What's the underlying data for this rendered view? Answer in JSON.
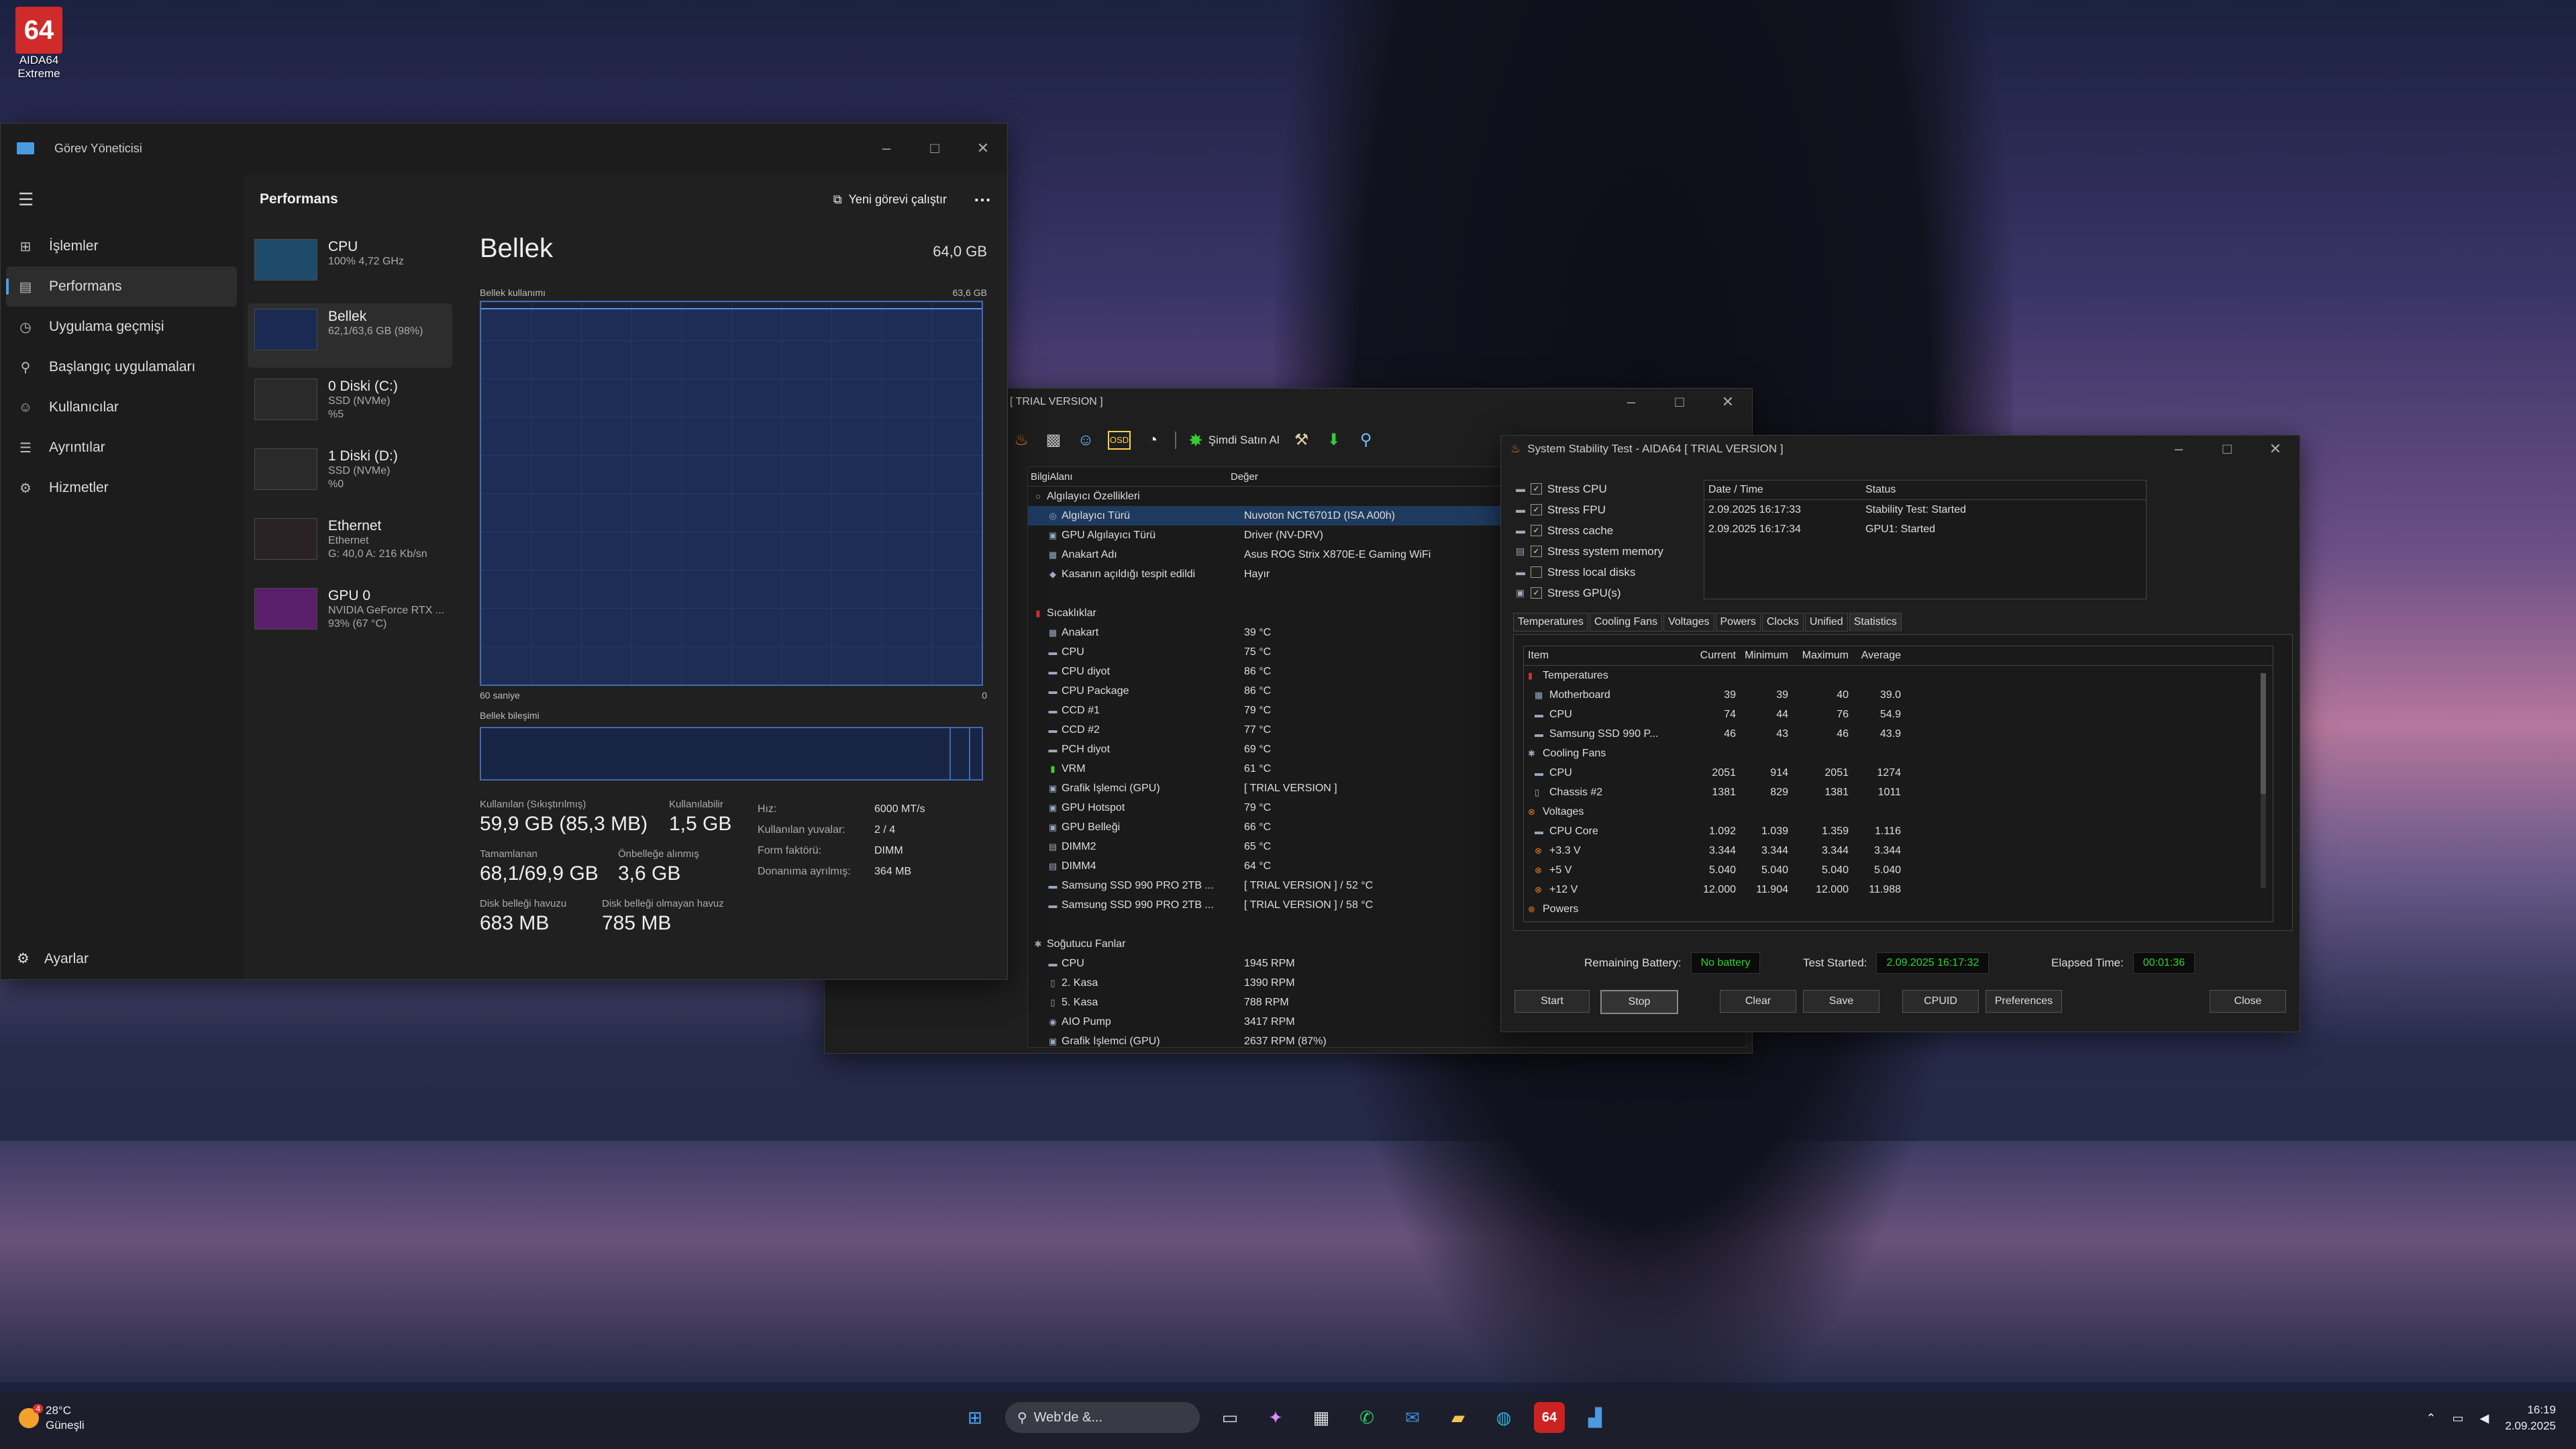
{
  "desktop": {
    "icon_tile": "64",
    "icon_label_1": "AIDA64",
    "icon_label_2": "Extreme"
  },
  "taskmgr": {
    "title": "Görev Yöneticisi",
    "nav": [
      {
        "label": "İşlemler",
        "icon": "grid-icon"
      },
      {
        "label": "Performans",
        "icon": "chart-icon"
      },
      {
        "label": "Uygulama geçmişi",
        "icon": "history-icon"
      },
      {
        "label": "Başlangıç uygulamaları",
        "icon": "startup-icon"
      },
      {
        "label": "Kullanıcılar",
        "icon": "users-icon"
      },
      {
        "label": "Ayrıntılar",
        "icon": "list-icon"
      },
      {
        "label": "Hizmetler",
        "icon": "services-icon"
      }
    ],
    "settings": "Ayarlar",
    "section_title": "Performans",
    "new_task": "Yeni görevi çalıştır",
    "devices": [
      {
        "name": "CPU",
        "l2": "100% 4,72 GHz",
        "l3": "",
        "color": "#1f4b6a"
      },
      {
        "name": "Bellek",
        "l2": "62,1/63,6 GB (98%)",
        "l3": "",
        "color": "#1a2a52"
      },
      {
        "name": "0 Diski (C:)",
        "l2": "SSD (NVMe)",
        "l3": "%5",
        "color": "#2a2a2a"
      },
      {
        "name": "1 Diski (D:)",
        "l2": "SSD (NVMe)",
        "l3": "%0",
        "color": "#2a2a2a"
      },
      {
        "name": "Ethernet",
        "l2": "Ethernet",
        "l3": "G: 40,0  A: 216 Kb/sn",
        "color": "#2b2226"
      },
      {
        "name": "GPU 0",
        "l2": "NVIDIA GeForce RTX ...",
        "l3": "93% (67 °C)",
        "color": "#5a1f6a"
      }
    ],
    "memory": {
      "title": "Bellek",
      "total": "64,0 GB",
      "usage_label": "Bellek kullanımı",
      "usage_max": "63,6 GB",
      "time_left": "60 saniye",
      "time_right": "0",
      "composition_label": "Bellek bileşimi",
      "used_fraction": 0.98,
      "stats": [
        {
          "k": "Kullanılan (Sıkıştırılmış)",
          "v": "59,9 GB (85,3 MB)"
        },
        {
          "k": "Kullanılabilir",
          "v": "1,5 GB"
        },
        {
          "k": "Tamamlanan",
          "v": "68,1/69,9 GB"
        },
        {
          "k": "Önbelleğe alınmış",
          "v": "3,6 GB"
        },
        {
          "k": "Disk belleği havuzu",
          "v": "683 MB"
        },
        {
          "k": "Disk belleği olmayan havuz",
          "v": "785 MB"
        }
      ],
      "kv": [
        {
          "k": "Hız:",
          "v": "6000 MT/s"
        },
        {
          "k": "Kullanılan yuvalar:",
          "v": "2 / 4"
        },
        {
          "k": "Form faktörü:",
          "v": "DIMM"
        },
        {
          "k": "Donanıma ayrılmış:",
          "v": "364 MB"
        }
      ]
    }
  },
  "aida": {
    "title": "[ TRIAL VERSION ]",
    "buy": "Şimdi Satın Al",
    "col1": "BilgiAlanı",
    "col2": "Değer",
    "rows": [
      {
        "l": "Algılayıcı Özellikleri",
        "v": "",
        "lvl": 0,
        "ic": "○"
      },
      {
        "l": "Algılayıcı Türü",
        "v": "Nuvoton NCT6701D  (ISA A00h)",
        "lvl": 1,
        "ic": "◎",
        "sel": true
      },
      {
        "l": "GPU Algılayıcı Türü",
        "v": "Driver  (NV-DRV)",
        "lvl": 1,
        "ic": "▣"
      },
      {
        "l": "Anakart Adı",
        "v": "Asus ROG Strix X870E-E Gaming WiFi",
        "lvl": 1,
        "ic": "▦"
      },
      {
        "l": "Kasanın açıldığı tespit edildi",
        "v": "Hayır",
        "lvl": 1,
        "ic": "◆"
      },
      {
        "l": "",
        "v": "",
        "lvl": 0,
        "ic": ""
      },
      {
        "l": "Sıcaklıklar",
        "v": "",
        "lvl": 0,
        "ic": "▮",
        "red": true
      },
      {
        "l": "Anakart",
        "v": "39 °C",
        "lvl": 1,
        "ic": "▦"
      },
      {
        "l": "CPU",
        "v": "75 °C",
        "lvl": 1,
        "ic": "▬"
      },
      {
        "l": "CPU diyot",
        "v": "86 °C",
        "lvl": 1,
        "ic": "▬"
      },
      {
        "l": "CPU Package",
        "v": "86 °C",
        "lvl": 1,
        "ic": "▬"
      },
      {
        "l": "CCD #1",
        "v": "79 °C",
        "lvl": 1,
        "ic": "▬"
      },
      {
        "l": "CCD #2",
        "v": "77 °C",
        "lvl": 1,
        "ic": "▬"
      },
      {
        "l": "PCH diyot",
        "v": "69 °C",
        "lvl": 1,
        "ic": "▬"
      },
      {
        "l": "VRM",
        "v": "61 °C",
        "lvl": 1,
        "ic": "▮",
        "g": true
      },
      {
        "l": "Grafik İşlemci (GPU)",
        "v": "[ TRIAL VERSION ]",
        "lvl": 1,
        "ic": "▣"
      },
      {
        "l": "GPU Hotspot",
        "v": "79 °C",
        "lvl": 1,
        "ic": "▣"
      },
      {
        "l": "GPU Belleği",
        "v": "66 °C",
        "lvl": 1,
        "ic": "▣"
      },
      {
        "l": "DIMM2",
        "v": "65 °C",
        "lvl": 1,
        "ic": "▤"
      },
      {
        "l": "DIMM4",
        "v": "64 °C",
        "lvl": 1,
        "ic": "▤"
      },
      {
        "l": "Samsung SSD 990 PRO 2TB ...",
        "v": "[ TRIAL VERSION ] / 52 °C",
        "lvl": 1,
        "ic": "▬"
      },
      {
        "l": "Samsung SSD 990 PRO 2TB ...",
        "v": "[ TRIAL VERSION ] / 58 °C",
        "lvl": 1,
        "ic": "▬"
      },
      {
        "l": "",
        "v": "",
        "lvl": 0,
        "ic": ""
      },
      {
        "l": "Soğutucu Fanlar",
        "v": "",
        "lvl": 0,
        "ic": "✱"
      },
      {
        "l": "CPU",
        "v": "1945 RPM",
        "lvl": 1,
        "ic": "▬"
      },
      {
        "l": "2. Kasa",
        "v": "1390 RPM",
        "lvl": 1,
        "ic": "▯"
      },
      {
        "l": "5. Kasa",
        "v": "788 RPM",
        "lvl": 1,
        "ic": "▯"
      },
      {
        "l": "AIO Pump",
        "v": "3417 RPM",
        "lvl": 1,
        "ic": "◉"
      },
      {
        "l": "Grafik İşlemci (GPU)",
        "v": "2637 RPM  (87%)",
        "lvl": 1,
        "ic": "▣"
      }
    ]
  },
  "sst": {
    "title": "System Stability Test - AIDA64  [ TRIAL VERSION ]",
    "stress": [
      {
        "label": "Stress CPU",
        "checked": true
      },
      {
        "label": "Stress FPU",
        "checked": true
      },
      {
        "label": "Stress cache",
        "checked": true
      },
      {
        "label": "Stress system memory",
        "checked": true
      },
      {
        "label": "Stress local disks",
        "checked": false
      },
      {
        "label": "Stress GPU(s)",
        "checked": true
      }
    ],
    "log_header": [
      "Date / Time",
      "Status"
    ],
    "log": [
      [
        "2.09.2025 16:17:33",
        "Stability Test: Started"
      ],
      [
        "2.09.2025 16:17:34",
        "GPU1: Started"
      ]
    ],
    "tabs": [
      "Temperatures",
      "Cooling Fans",
      "Voltages",
      "Powers",
      "Clocks",
      "Unified",
      "Statistics"
    ],
    "stat_header": [
      "Item",
      "Current",
      "Minimum",
      "Maximum",
      "Average"
    ],
    "stat_rows": [
      {
        "item": "Temperatures",
        "group": true,
        "ic": "▮",
        "c": "red"
      },
      {
        "item": "Motherboard",
        "v": [
          "39",
          "39",
          "40",
          "39.0"
        ],
        "ic": "▦"
      },
      {
        "item": "CPU",
        "v": [
          "74",
          "44",
          "76",
          "54.9"
        ],
        "ic": "▬"
      },
      {
        "item": "Samsung SSD 990 P...",
        "v": [
          "46",
          "43",
          "46",
          "43.9"
        ],
        "ic": "▬"
      },
      {
        "item": "Cooling Fans",
        "group": true,
        "ic": "✱"
      },
      {
        "item": "CPU",
        "v": [
          "2051",
          "914",
          "2051",
          "1274"
        ],
        "ic": "▬"
      },
      {
        "item": "Chassis #2",
        "v": [
          "1381",
          "829",
          "1381",
          "1011"
        ],
        "ic": "▯"
      },
      {
        "item": "Voltages",
        "group": true,
        "ic": "⊗",
        "c": "orange"
      },
      {
        "item": "CPU Core",
        "v": [
          "1.092",
          "1.039",
          "1.359",
          "1.116"
        ],
        "ic": "▬"
      },
      {
        "item": "+3.3 V",
        "v": [
          "3.344",
          "3.344",
          "3.344",
          "3.344"
        ],
        "ic": "⊗",
        "c": "orange"
      },
      {
        "item": "+5 V",
        "v": [
          "5.040",
          "5.040",
          "5.040",
          "5.040"
        ],
        "ic": "⊗",
        "c": "orange"
      },
      {
        "item": "+12 V",
        "v": [
          "12.000",
          "11.904",
          "12.000",
          "11.988"
        ],
        "ic": "⊗",
        "c": "orange"
      },
      {
        "item": "Powers",
        "group": true,
        "ic": "⊗",
        "c": "orange"
      }
    ],
    "remaining_battery_label": "Remaining Battery:",
    "remaining_battery": "No battery",
    "test_started_label": "Test Started:",
    "test_started": "2.09.2025 16:17:32",
    "elapsed_label": "Elapsed Time:",
    "elapsed": "00:01:36",
    "buttons": {
      "start": "Start",
      "stop": "Stop",
      "clear": "Clear",
      "save": "Save",
      "cpuid": "CPUID",
      "preferences": "Preferences",
      "close": "Close"
    }
  },
  "taskbar": {
    "temp": "28°C",
    "weather": "Güneşli",
    "badge": "4",
    "search": "Web'de &...",
    "time": "16:19",
    "date": "2.09.2025"
  }
}
